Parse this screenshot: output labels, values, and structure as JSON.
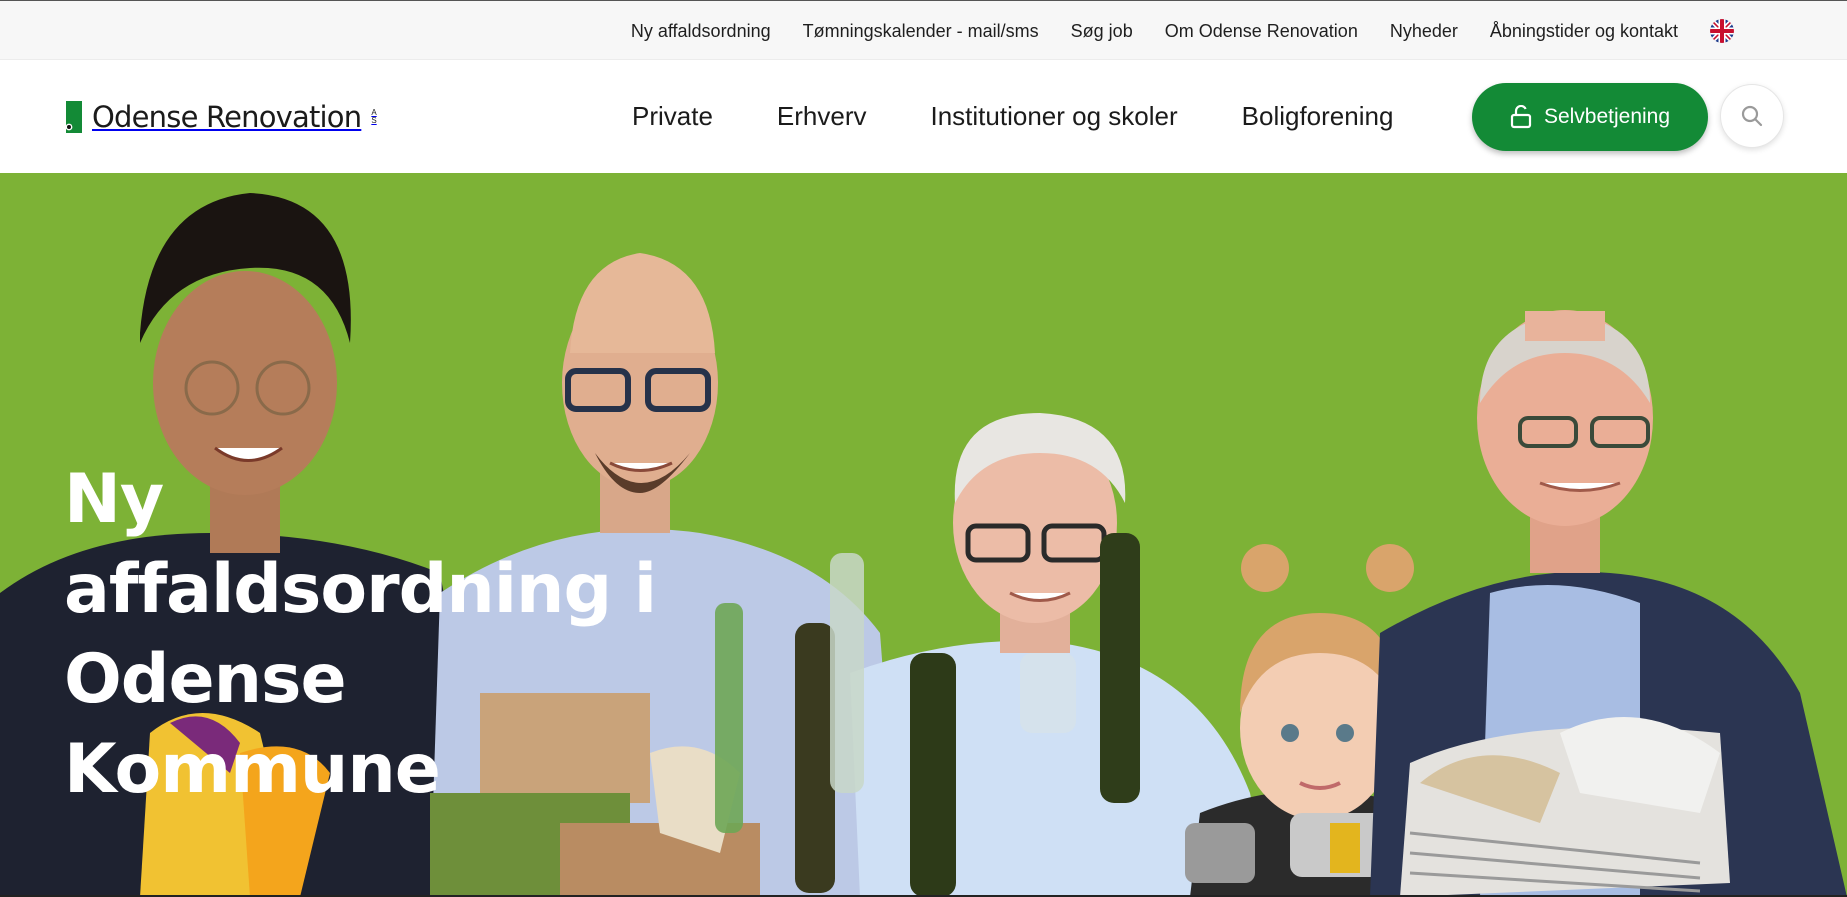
{
  "topbar": {
    "links": [
      "Ny affaldsordning",
      "Tømningskalender - mail/sms",
      "Søg job",
      "Om Odense Renovation",
      "Nyheder",
      "Åbningstider og kontakt"
    ],
    "language_icon": "uk-flag-icon"
  },
  "header": {
    "logo_text": "Odense Renovation",
    "logo_suffix": "A S",
    "nav": [
      "Private",
      "Erhverv",
      "Institutioner og skoler",
      "Boligforening"
    ],
    "selvbetjening_label": "Selvbetjening",
    "selvbetjening_icon": "unlock-icon",
    "search_icon": "search-icon"
  },
  "hero": {
    "title_line1": "Ny affaldsordning i",
    "title_line2": "Odense Kommune",
    "background_color": "#7db236"
  },
  "colors": {
    "brand_green": "#138a36",
    "hero_green": "#7db236"
  }
}
